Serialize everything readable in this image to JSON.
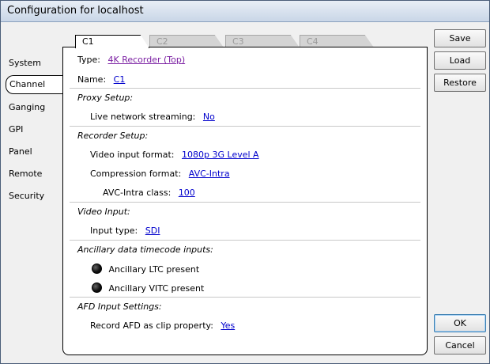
{
  "window": {
    "title": "Configuration for localhost"
  },
  "sidebar": {
    "items": [
      {
        "label": "System"
      },
      {
        "label": "Channel"
      },
      {
        "label": "Ganging"
      },
      {
        "label": "GPI"
      },
      {
        "label": "Panel"
      },
      {
        "label": "Remote"
      },
      {
        "label": "Security"
      }
    ],
    "selected": "Channel"
  },
  "tabs": [
    {
      "label": "C1"
    },
    {
      "label": "C2"
    },
    {
      "label": "C3"
    },
    {
      "label": "C4"
    }
  ],
  "channel": {
    "type_label": "Type:",
    "type_value": "4K Recorder (Top)",
    "name_label": "Name:",
    "name_value": "C1",
    "proxy": {
      "heading": "Proxy Setup:",
      "streaming_label": "Live network streaming:",
      "streaming_value": "No"
    },
    "recorder": {
      "heading": "Recorder Setup:",
      "video_format_label": "Video input format:",
      "video_format_value": "1080p 3G Level A",
      "compression_label": "Compression format:",
      "compression_value": "AVC-Intra",
      "class_label": "AVC-Intra class:",
      "class_value": "100"
    },
    "video_input": {
      "heading": "Video Input:",
      "input_type_label": "Input type:",
      "input_type_value": "SDI"
    },
    "ancillary": {
      "heading": "Ancillary data timecode inputs:",
      "ltc_label": "Ancillary LTC present",
      "vitc_label": "Ancillary VITC present"
    },
    "afd": {
      "heading": "AFD Input Settings:",
      "record_label": "Record AFD as clip property:",
      "record_value": "Yes"
    }
  },
  "buttons": {
    "save": "Save",
    "load": "Load",
    "restore": "Restore",
    "ok": "OK",
    "cancel": "Cancel"
  }
}
